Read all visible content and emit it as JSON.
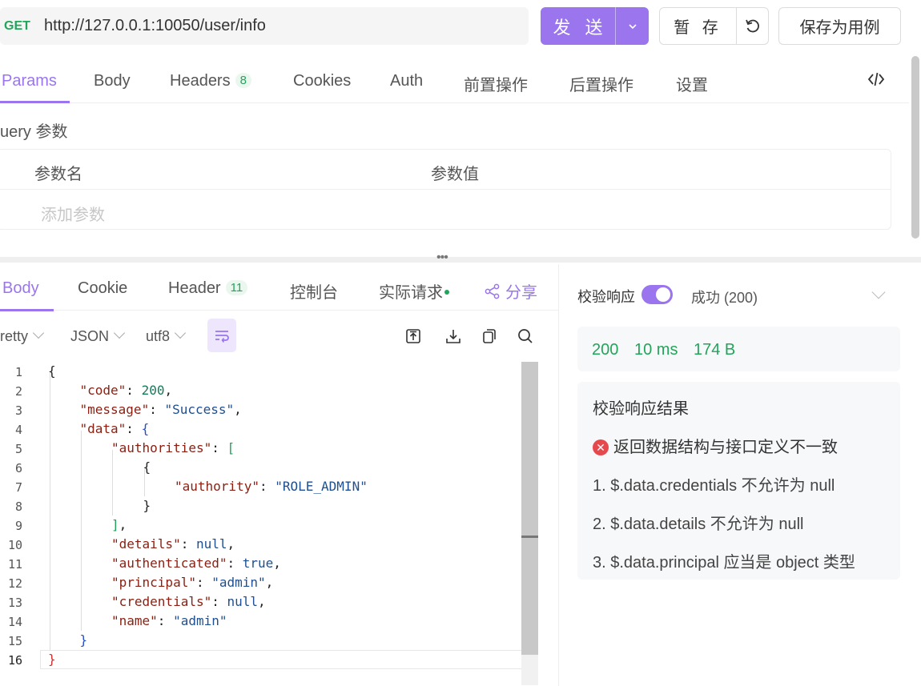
{
  "request": {
    "method": "GET",
    "url": "http://127.0.0.1:10050/user/info",
    "send_label": "发 送",
    "save_temp_label": "暂 存",
    "save_case_label": "保存为用例"
  },
  "request_tabs": {
    "params": "Params",
    "body": "Body",
    "headers": "Headers",
    "headers_count": "8",
    "cookies": "Cookies",
    "auth": "Auth",
    "pre": "前置操作",
    "post": "后置操作",
    "settings": "设置"
  },
  "query": {
    "title": "uery 参数",
    "col_name": "参数名",
    "col_value": "参数值",
    "add_placeholder": "添加参数"
  },
  "response_tabs": {
    "body": "Body",
    "cookie": "Cookie",
    "header": "Header",
    "header_count": "11",
    "console": "控制台",
    "actual": "实际请求",
    "share": "分享"
  },
  "response_toolbar": {
    "format": "retty",
    "type": "JSON",
    "encoding": "utf8"
  },
  "code_lines": [
    [
      [
        "p",
        "{"
      ]
    ],
    [
      [
        "k",
        "\"code\""
      ],
      [
        "p",
        ": "
      ],
      [
        "n",
        "200"
      ],
      [
        "p",
        ","
      ]
    ],
    [
      [
        "k",
        "\"message\""
      ],
      [
        "p",
        ": "
      ],
      [
        "s",
        "\"Success\""
      ],
      [
        "p",
        ","
      ]
    ],
    [
      [
        "k",
        "\"data\""
      ],
      [
        "p",
        ": "
      ],
      [
        "br-blue",
        "{"
      ]
    ],
    [
      [
        "k",
        "\"authorities\""
      ],
      [
        "p",
        ": "
      ],
      [
        "br-green",
        "["
      ]
    ],
    [
      [
        "p",
        "{"
      ]
    ],
    [
      [
        "k",
        "\"authority\""
      ],
      [
        "p",
        ": "
      ],
      [
        "s",
        "\"ROLE_ADMIN\""
      ]
    ],
    [
      [
        "p",
        "}"
      ]
    ],
    [
      [
        "br-green",
        "]"
      ],
      [
        "p",
        ","
      ]
    ],
    [
      [
        "k",
        "\"details\""
      ],
      [
        "p",
        ": "
      ],
      [
        "b",
        "null"
      ],
      [
        "p",
        ","
      ]
    ],
    [
      [
        "k",
        "\"authenticated\""
      ],
      [
        "p",
        ": "
      ],
      [
        "b",
        "true"
      ],
      [
        "p",
        ","
      ]
    ],
    [
      [
        "k",
        "\"principal\""
      ],
      [
        "p",
        ": "
      ],
      [
        "s",
        "\"admin\""
      ],
      [
        "p",
        ","
      ]
    ],
    [
      [
        "k",
        "\"credentials\""
      ],
      [
        "p",
        ": "
      ],
      [
        "b",
        "null"
      ],
      [
        "p",
        ","
      ]
    ],
    [
      [
        "k",
        "\"name\""
      ],
      [
        "p",
        ": "
      ],
      [
        "s",
        "\"admin\""
      ]
    ],
    [
      [
        "br-blue",
        "}"
      ]
    ],
    [
      [
        "br-red",
        "}"
      ]
    ]
  ],
  "code_indent": [
    0,
    1,
    1,
    1,
    2,
    3,
    4,
    3,
    2,
    2,
    2,
    2,
    2,
    2,
    1,
    0
  ],
  "validation": {
    "label": "校验响应",
    "enabled": true,
    "result": "成功 (200)",
    "status_code": "200",
    "time": "10 ms",
    "size": "174 B",
    "result_title": "校验响应结果",
    "error": "返回数据结构与接口定义不一致",
    "items": [
      "1. $.data.credentials 不允许为 null",
      "2. $.data.details 不允许为 null",
      "3. $.data.principal 应当是 object 类型"
    ]
  }
}
